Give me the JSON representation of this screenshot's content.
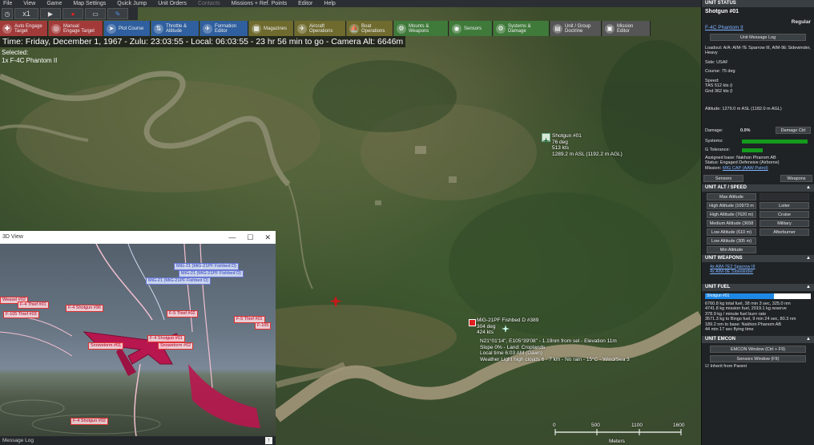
{
  "menu": [
    "File",
    "View",
    "Game",
    "Map Settings",
    "Quick Jump",
    "Unit Orders",
    "Contacts",
    "Missions + Ref. Points",
    "Editor",
    "Help"
  ],
  "toolbar": {
    "speed": "x1"
  },
  "toolbar2": [
    {
      "label": "Auto Engage\nTarget",
      "icon": "crosshair-icon",
      "color": "#a33a3a"
    },
    {
      "label": "Manual\nEngage Target",
      "icon": "target-icon",
      "color": "#a33a3a"
    },
    {
      "label": "Plot Course",
      "icon": "course-icon",
      "color": "#2f5f9e"
    },
    {
      "label": "Throttle &\nAltitude",
      "icon": "throttle-icon",
      "color": "#2f5f9e"
    },
    {
      "label": "Formation\nEditor",
      "icon": "formation-icon",
      "color": "#2f5f9e"
    },
    {
      "label": "Magazines",
      "icon": "magazine-icon",
      "color": "#6f6a2e"
    },
    {
      "label": "Aircraft\nOperations",
      "icon": "aircraft-icon",
      "color": "#6f6a2e"
    },
    {
      "label": "Boat\nOperations",
      "icon": "boat-icon",
      "color": "#6f6a2e"
    },
    {
      "label": "Mounts &\nWeapons",
      "icon": "weapons-icon",
      "color": "#3f7a3a"
    },
    {
      "label": "Sensors",
      "icon": "sensor-icon",
      "color": "#3f7a3a"
    },
    {
      "label": "Systems &\nDamage",
      "icon": "gear-icon",
      "color": "#3f7a3a"
    },
    {
      "label": "Unit / Group\nDoctrine",
      "icon": "doctrine-icon",
      "color": "#555"
    },
    {
      "label": "Mission\nEditor",
      "icon": "mission-icon",
      "color": "#555"
    }
  ],
  "timebar": "Time: Friday, December 1, 1967 - Zulu: 23:03:55 - Local: 06:03:55 - 23 hr 56 min to go -  Camera Alt: 6646m",
  "selected": {
    "title": "Selected:",
    "unit": "1x F-4C Phantom II"
  },
  "map": {
    "shotgun": [
      "Shotgun #01",
      "76 deg",
      "513 kts",
      "1289.2 m ASL (1192.2 m AGL)"
    ],
    "mig": [
      "MiG-21PF Fishbed D #389",
      "304 deg",
      "424 kts"
    ],
    "info": [
      "N21°01'14\", E105°39'08\" - 1.19nm from sel - Elevation 11m",
      "Slope 0% - Land: Croplands",
      "Local time 6:03 AM (Dawn)",
      "Weather Light high clouds 6 - 7 km - No rain - 15°C - Wind/Sea 3"
    ],
    "scale": [
      "0",
      "500",
      "1100",
      "1600"
    ],
    "scale_unit": "Meters"
  },
  "view3d": {
    "title": "3D View",
    "blue_tags": [
      "MiG-21 (MiG-21PF Fishbed D)",
      "MiG-21 (MiG-21PF Fishbed D)",
      "MiG-21 (MiG-21PF Fishbed D)"
    ],
    "red_tags": [
      "Weasel #02",
      "F-4 Thief #01",
      "F-4 Shotgun #96",
      "F-105 Thief #03",
      "F-5 Thief #02",
      "F-5 Thief #01",
      "F-4 Shotgun #01",
      "Snowstorm #02",
      "Snowstorm #01",
      "F-4 Shotgun #02",
      "F-105"
    ]
  },
  "msglog": "Message Log",
  "panel": {
    "unit_status_header": "UNIT STATUS",
    "unit_name": "Shotgun #01",
    "rank": "Regular",
    "aircraft_link": "F-4C Phantom II",
    "unit_message_log": "Unit Message Log",
    "loadout": "Loadout: A/A: AIM-7E Sparrow III, AIM-9E Sidewinder, Heavy",
    "side": "Side: USAF",
    "course": "Course: 75 deg",
    "speed_title": "Speed:",
    "tas": "TAS 512 kts (i",
    "gnd": "Gnd 362 kts (l",
    "altitude": "Altitude: 1279.0 m ASL (1182.0 m AGL)",
    "damage_label": "Damage:",
    "damage_value": "0.0%",
    "damage_ctrl": "Damage Ctrl",
    "systems": "Systems:",
    "gtol": "G Tolerance:",
    "base": "Assigned base: Nakhon Phanom AB",
    "status": "Status: Engaged Defensive (Airborne)",
    "mission_label": "Mission:",
    "mission_link": "MIG CAP (AAW Patrol)",
    "sensors_btn": "Sensors",
    "weapons_btn": "Weapons",
    "alt_speed_header": "UNIT ALT / SPEED",
    "alt_buttons": [
      "Max Altitude",
      "High Altitude (10973 m",
      "High Altitude (7620 m)",
      "Medium Altitude (3658",
      "Low Altitude (610 m)",
      "Low Altitude (305 m)",
      "Min Altitude"
    ],
    "speed_buttons": [
      "",
      "Loiter",
      "Cruise",
      "Military",
      "Afterburner"
    ],
    "weapons_header": "UNIT WEAPONS",
    "weapons": [
      "4x AIM-7E2 Sparrow III",
      "4x AIM-9E Sidewinder"
    ],
    "fuel_header": "UNIT FUEL",
    "fuel_bar": "Shotgun #01",
    "fuel_fraction": 0.65,
    "fuel_text": [
      "6760.8 kg total fuel, 38 min 3 sec, 325.0 nm",
      "4741.8 kg mission fuel, 2019.1 kg reserve",
      "378.9 kg / minute fuel burn rate",
      "3571.3 kg to Bingo fuel, 9 min 24 sec, 80.3 nm",
      "189.2 nm to base: Nakhon Phanom AB",
      "44 min 17 sec flying time"
    ],
    "emcon_header": "UNIT EMCON",
    "emcon_btn": "EMCON Window (Ctrl + F9)",
    "sensors_window": "Sensors Window (F9)",
    "inherit": "Inherit from Parent"
  },
  "colors": {
    "bar_green": "#149a1d",
    "fuel_blue": "#1e88e5",
    "hostile": "#e02020"
  }
}
